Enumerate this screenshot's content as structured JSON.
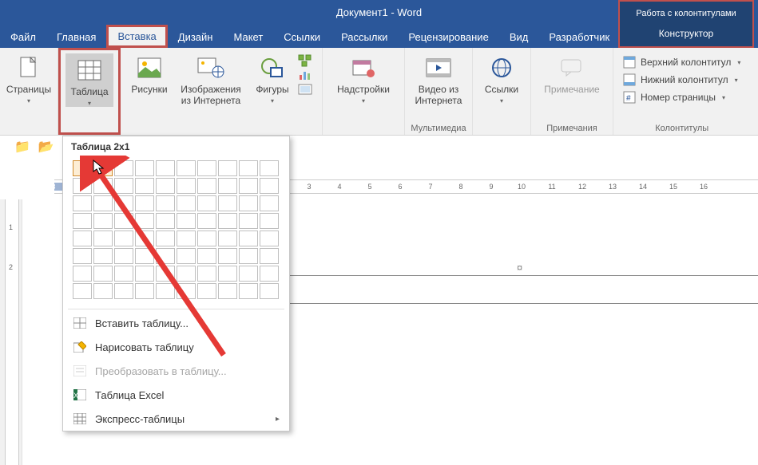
{
  "title": "Документ1 - Word",
  "context_tool": {
    "group": "Работа с колонтитулами",
    "tab": "Конструктор"
  },
  "tabs": {
    "file": "Файл",
    "home": "Главная",
    "insert": "Вставка",
    "design": "Дизайн",
    "layout": "Макет",
    "references": "Ссылки",
    "mailings": "Рассылки",
    "review": "Рецензирование",
    "view": "Вид",
    "developer": "Разработчик"
  },
  "ribbon": {
    "pages": "Страницы",
    "table": "Таблица",
    "pictures": "Рисунки",
    "online_pictures_l1": "Изображения",
    "online_pictures_l2": "из Интернета",
    "shapes": "Фигуры",
    "addins": "Надстройки",
    "video_l1": "Видео из",
    "video_l2": "Интернета",
    "links": "Ссылки",
    "comment": "Примечание",
    "header": "Верхний колонтитул",
    "footer": "Нижний колонтитул",
    "page_number": "Номер страницы",
    "grp_media": "Мультимедиа",
    "grp_comments": "Примечания",
    "grp_hf": "Колонтитулы"
  },
  "ruler": {
    "left_num": "3",
    "nums": [
      "3",
      "4",
      "5",
      "6",
      "7",
      "8",
      "9",
      "10",
      "11",
      "12",
      "13",
      "14",
      "15",
      "16"
    ],
    "v": [
      "1",
      "2"
    ]
  },
  "table_panel": {
    "title": "Таблица 2x1",
    "insert": "Вставить таблицу...",
    "draw": "Нарисовать таблицу",
    "convert": "Преобразовать в таблицу...",
    "excel": "Таблица Excel",
    "quick": "Экспресс-таблицы"
  },
  "header_mark": "¤"
}
